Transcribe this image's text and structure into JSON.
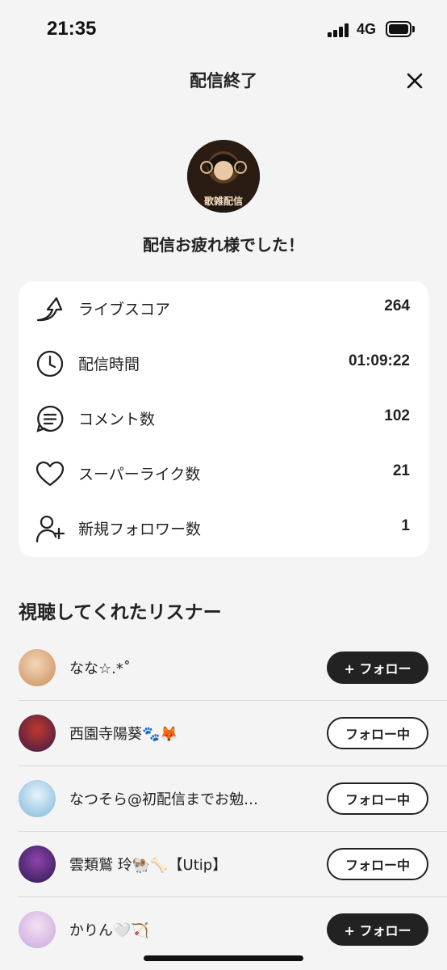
{
  "status_bar": {
    "time": "21:35",
    "network": "4G"
  },
  "header": {
    "title": "配信終了"
  },
  "hero": {
    "message": "配信お疲れ様でした！",
    "avatar_text": "歌雑配信"
  },
  "stats": [
    {
      "icon": "arrow-score-icon",
      "label": "ライブスコア",
      "value": "264"
    },
    {
      "icon": "clock-icon",
      "label": "配信時間",
      "value": "01:09:22"
    },
    {
      "icon": "comment-icon",
      "label": "コメント数",
      "value": "102"
    },
    {
      "icon": "heart-icon",
      "label": "スーパーライク数",
      "value": "21"
    },
    {
      "icon": "add-user-icon",
      "label": "新規フォロワー数",
      "value": "1"
    }
  ],
  "listeners": {
    "title": "視聴してくれたリスナー",
    "items": [
      {
        "name": "なな☆.*˚",
        "button": "+ フォロー",
        "following": false,
        "avatar_colors": [
          "#f4d6b8",
          "#c98d5a"
        ]
      },
      {
        "name": "西園寺陽葵🐾🦊",
        "button": "フォロー中",
        "following": true,
        "avatar_colors": [
          "#3b1a4a",
          "#c0392b"
        ]
      },
      {
        "name": "なつそら@初配信までお勉…",
        "button": "フォロー中",
        "following": true,
        "avatar_colors": [
          "#bfe3f5",
          "#7fb6d9"
        ]
      },
      {
        "name": "雲類鷲 玲🐏🦴【Utip】",
        "button": "フォロー中",
        "following": true,
        "avatar_colors": [
          "#2b1a4f",
          "#8e44ad"
        ]
      },
      {
        "name": "かりん🤍🏹",
        "button": "+ フォロー",
        "following": false,
        "avatar_colors": [
          "#f3e0f2",
          "#c9a7e0"
        ]
      }
    ]
  },
  "colors": {
    "accent": "#222222",
    "background": "#f4f4f4",
    "card": "#ffffff"
  }
}
